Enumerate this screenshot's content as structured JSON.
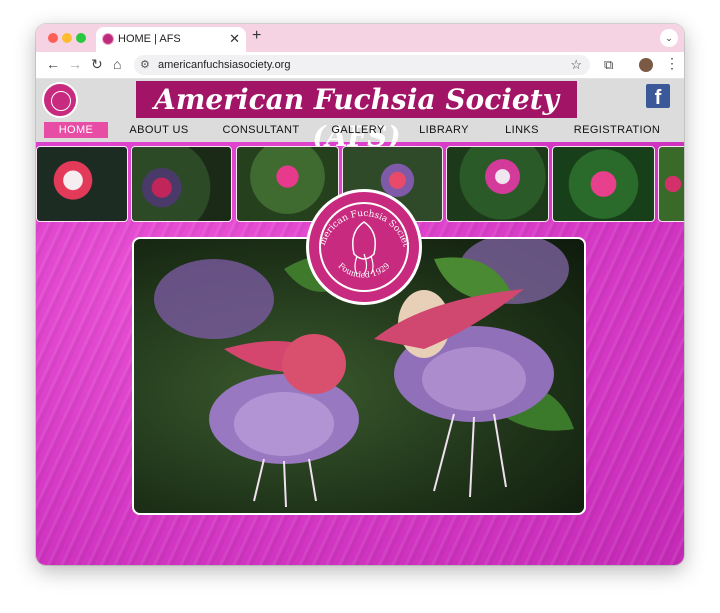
{
  "browser": {
    "tab_title": "HOME | AFS",
    "new_tab_label": "+",
    "url": "americanfuchsiasociety.org"
  },
  "site": {
    "banner_title": "American Fuchsia Society (AFS)",
    "facebook_glyph": "f",
    "seal_text_top": "American Fuchsia Society",
    "seal_text_bottom": "Founded 1929",
    "brand_color": "#a21466",
    "accent_color": "#e84da6"
  },
  "nav": {
    "items": [
      {
        "label": "HOME",
        "active": true
      },
      {
        "label": "ABOUT US",
        "active": false
      },
      {
        "label": "CONSULTANT",
        "active": false
      },
      {
        "label": "GALLERY",
        "active": false
      },
      {
        "label": "LIBRARY",
        "active": false
      },
      {
        "label": "LINKS",
        "active": false
      },
      {
        "label": "REGISTRATION",
        "active": false
      }
    ]
  },
  "icons": {
    "back": "arrow-left-icon",
    "forward": "arrow-right-icon",
    "reload": "reload-icon",
    "home": "home-icon",
    "site_info": "site-info-icon",
    "bookmark": "star-icon",
    "extensions": "puzzle-icon",
    "menu": "kebab-icon",
    "facebook": "facebook-icon"
  }
}
